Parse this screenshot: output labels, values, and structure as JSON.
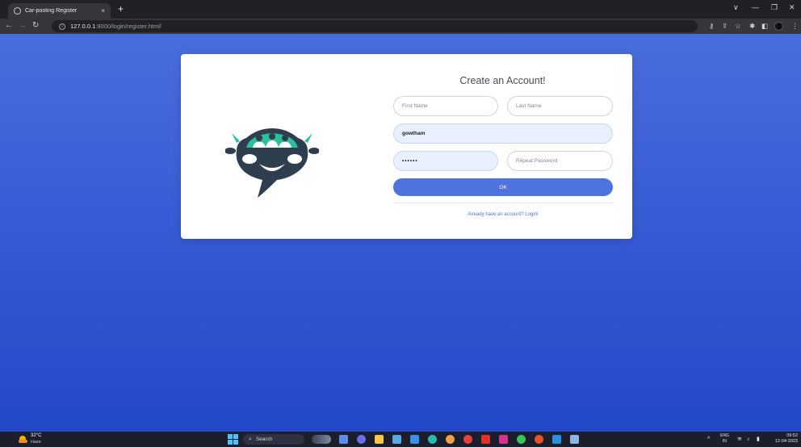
{
  "browser": {
    "tab_title": "Car-pooling Register",
    "tab_close": "×",
    "new_tab": "+",
    "url_host": "127.0.0.1",
    "url_path": ":8000/login/register.html/",
    "window_controls": [
      "∨",
      "—",
      "❐",
      "✕"
    ]
  },
  "form": {
    "title": "Create an Account!",
    "first_name_placeholder": "First Name",
    "last_name_placeholder": "Last Name",
    "username_value": "gowtham",
    "password_value": "••••••",
    "repeat_password_placeholder": "Repeat Password",
    "submit_label": "OK",
    "login_link": "Already have an account? Login!"
  },
  "colors": {
    "accent": "#4e73df",
    "background_top": "#4a6ddc",
    "background_bottom": "#2347c9",
    "logo_dark": "#2f3e4f",
    "logo_teal": "#2bbf9c"
  },
  "taskbar": {
    "weather_temp": "32°C",
    "weather_desc": "Haze",
    "search_label": "Search",
    "lang_top": "ENG",
    "lang_bottom": "IN",
    "time": "09:52",
    "date": "12-04-2023"
  }
}
